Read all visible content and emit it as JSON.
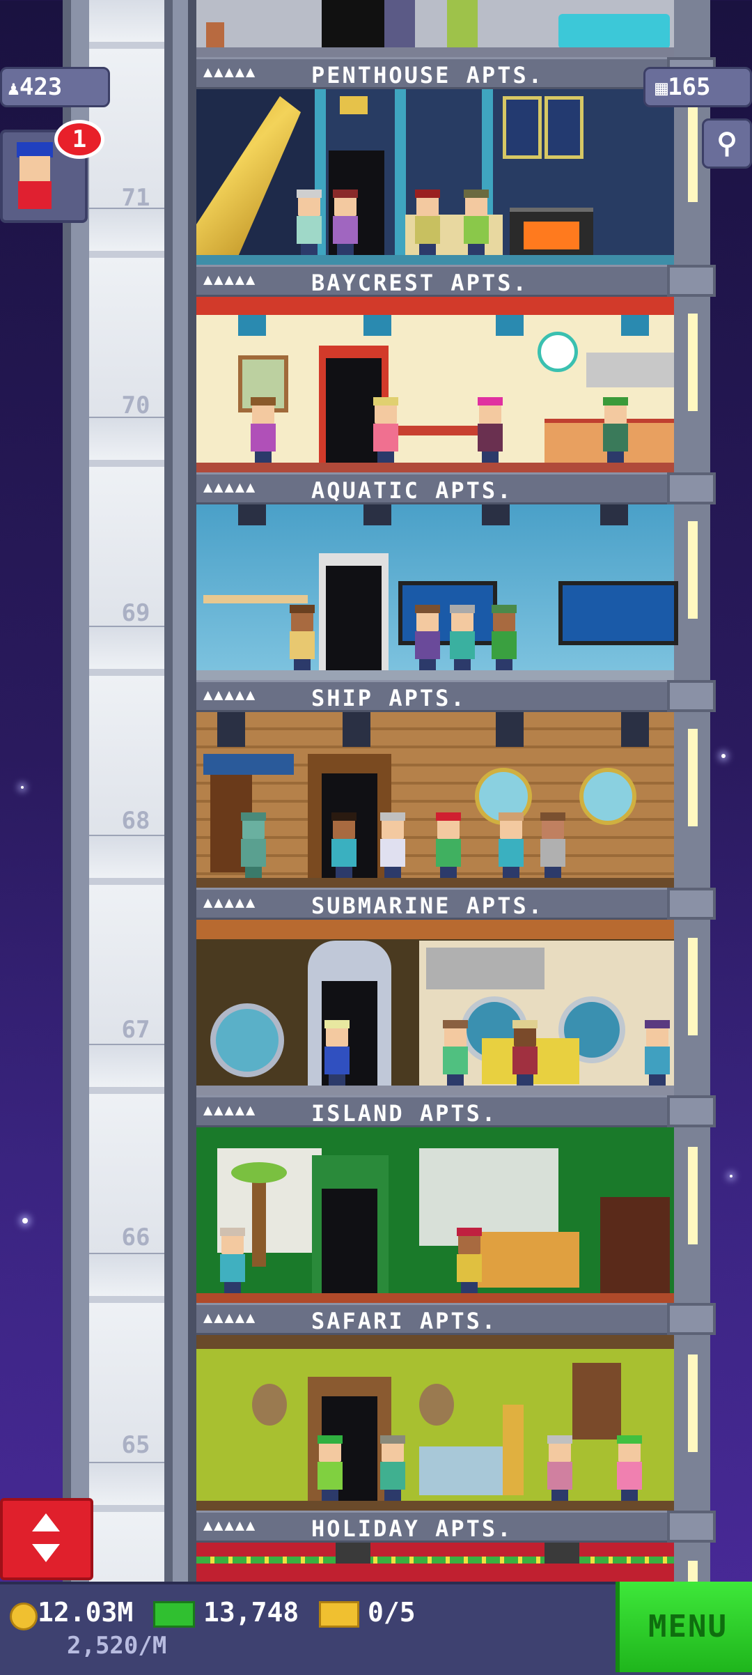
{
  "hud": {
    "population": "423",
    "bux": "165",
    "notification_count": "1"
  },
  "elevator_floor_numbers": [
    "71",
    "70",
    "69",
    "68",
    "67",
    "66",
    "65"
  ],
  "floors": [
    {
      "title": "PENTHOUSE APTS.",
      "stars": "▲▲▲▲▲"
    },
    {
      "title": "BAYCREST APTS.",
      "stars": "▲▲▲▲▲"
    },
    {
      "title": "AQUATIC APTS.",
      "stars": "▲▲▲▲▲"
    },
    {
      "title": "SHIP APTS.",
      "stars": "▲▲▲▲▲"
    },
    {
      "title": "SUBMARINE APTS.",
      "stars": "▲▲▲▲▲"
    },
    {
      "title": "ISLAND APTS.",
      "stars": "▲▲▲▲▲"
    },
    {
      "title": "SAFARI APTS.",
      "stars": "▲▲▲▲▲"
    },
    {
      "title": "HOLIDAY APTS.",
      "stars": "▲▲▲▲▲"
    }
  ],
  "bottom": {
    "coins": "12.03M",
    "coin_rate": "2,520/M",
    "bux_total": "13,748",
    "tickets": "0/5",
    "menu_label": "MENU"
  },
  "colors": {
    "menu_green": "#2fd42b",
    "elevator_red": "#e0202c",
    "banner_gray": "#6a7086"
  }
}
